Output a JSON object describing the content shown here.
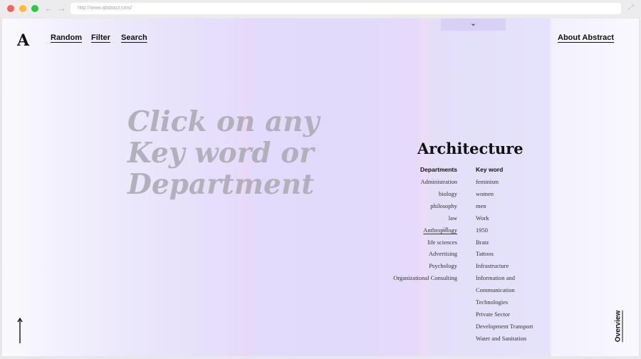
{
  "browser": {
    "url": "http://www.abstract.com/"
  },
  "header": {
    "logo": "A",
    "nav": {
      "random": "Random",
      "filter": "Filter",
      "search": "Search"
    },
    "about": "About Abstract"
  },
  "main": {
    "headline_lines": [
      "Click on any",
      "Key word or",
      "Department"
    ]
  },
  "panel": {
    "title": "Architecture",
    "departments_heading": "Departments",
    "keywords_heading": "Key word",
    "departments": [
      "Administration",
      "biology",
      "philosophy",
      "law",
      "Anthropology",
      "life sciences",
      "Advertising",
      "Psychology",
      "Organizational Consulting"
    ],
    "keywords": [
      "feminism",
      "women",
      "men",
      "Work",
      "1950",
      "Bratz",
      "Tattoos",
      "Infrastructure",
      "Information and",
      "Communication",
      "Technologies",
      "Private Sector",
      "Development  Transport",
      "Water and Sanitation"
    ]
  },
  "footer": {
    "overview": "Overview"
  },
  "icons": {
    "chevron": "chevron-down-icon",
    "back": "arrow-left-icon",
    "forward": "arrow-right-icon",
    "expand": "expand-icon",
    "up": "arrow-up-icon",
    "cursor": "cursor-pointer-icon"
  },
  "colors": {
    "text": "#111111",
    "headline": "#b3b0bb",
    "accent_lavender": "#e2dafa",
    "tab": "#d9d0f6"
  }
}
